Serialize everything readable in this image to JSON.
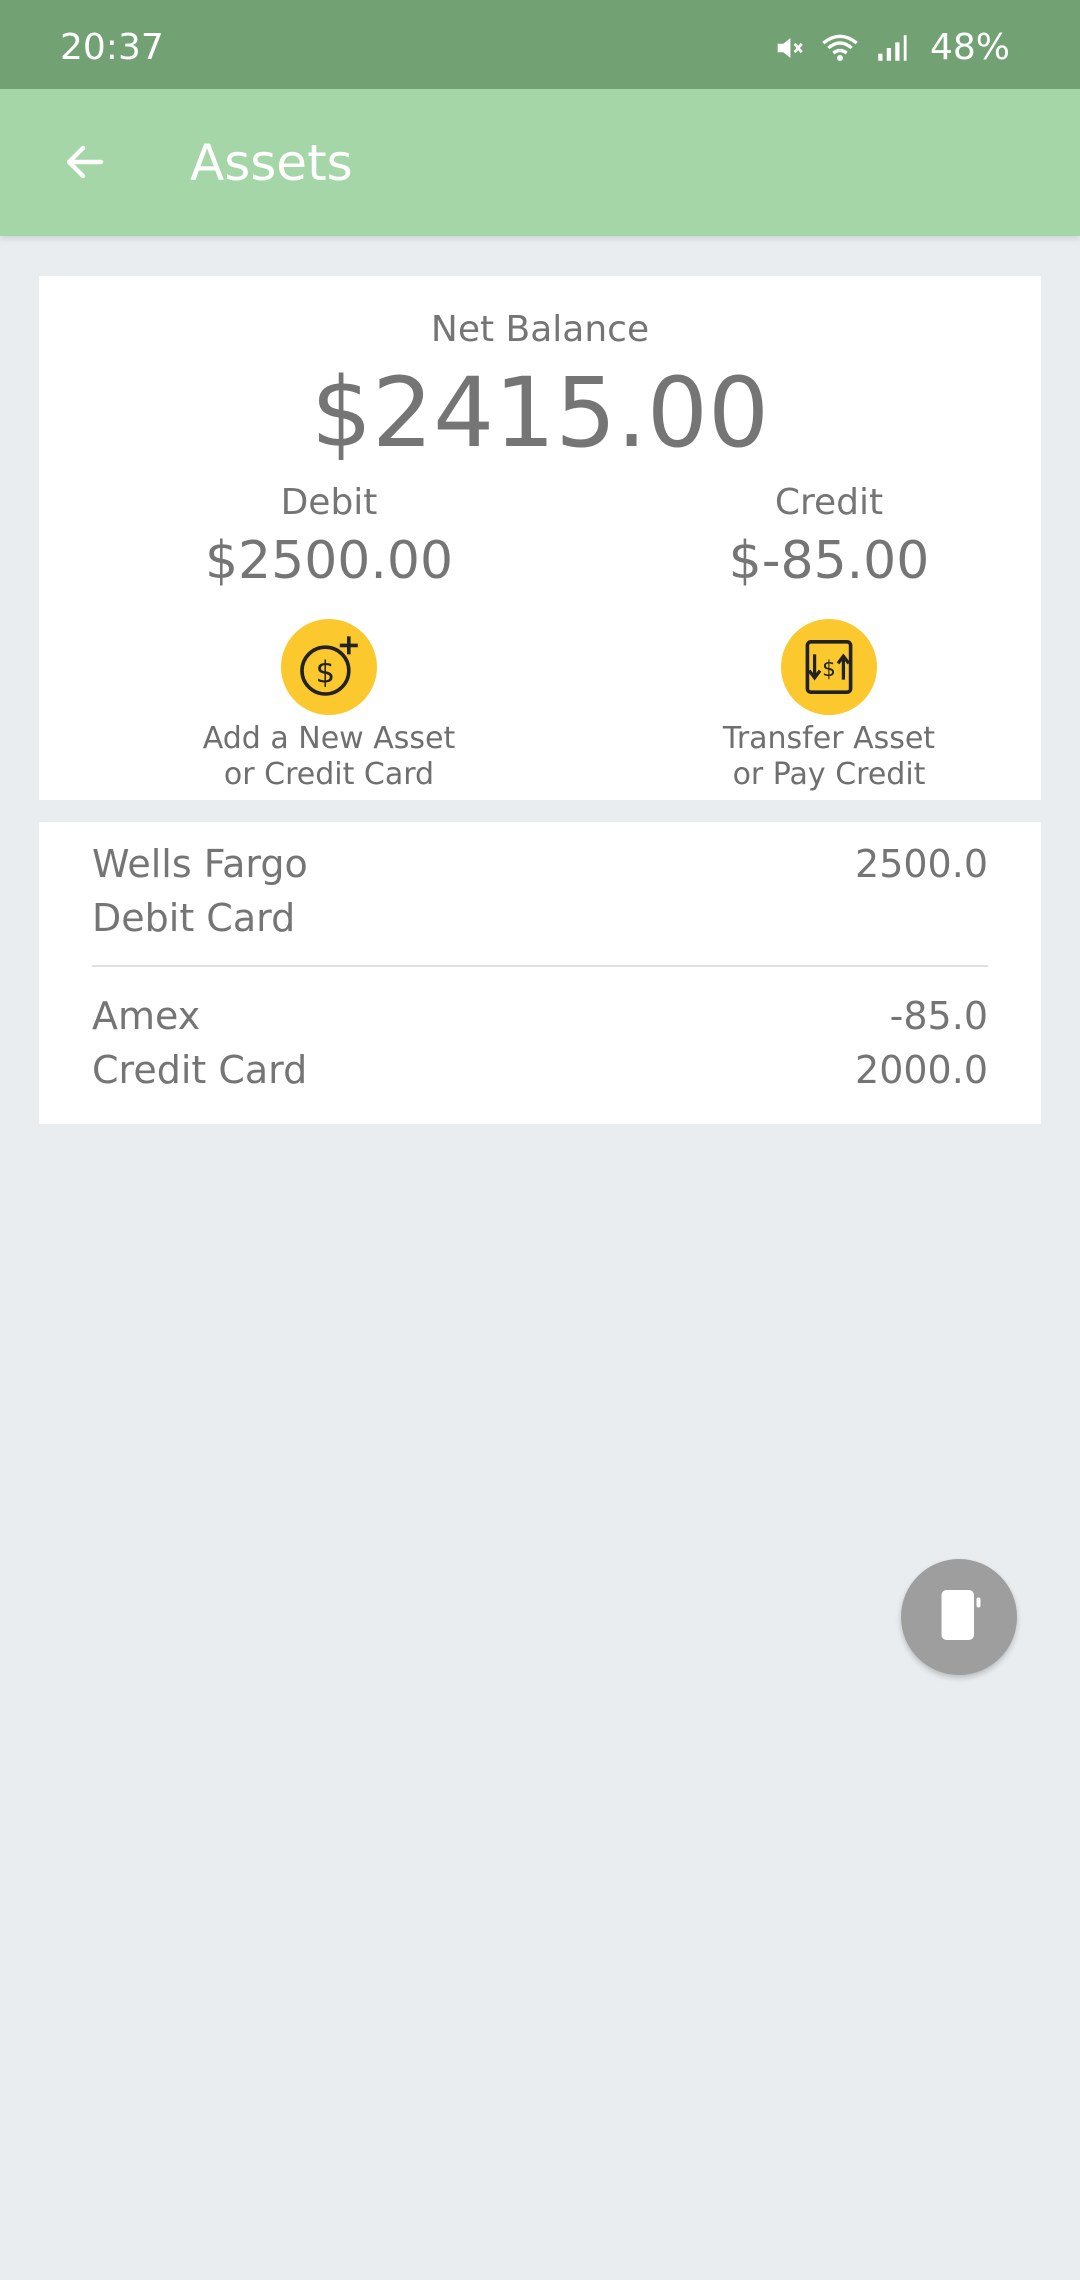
{
  "status_bar": {
    "time": "20:37",
    "battery": "48%",
    "icons": [
      "mute-icon",
      "wifi-icon",
      "signal-icon"
    ]
  },
  "app_bar": {
    "title": "Assets",
    "back_icon": "back-arrow-icon"
  },
  "summary": {
    "net_balance_label": "Net Balance",
    "net_balance_value": "$2415.00",
    "debit_label": "Debit",
    "debit_value": "$2500.00",
    "credit_label": "Credit",
    "credit_value": "$-85.00",
    "add_asset_line1": "Add a New Asset",
    "add_asset_line2": "or Credit Card",
    "add_asset_icon": "dollar-coin-plus-icon",
    "transfer_line1": "Transfer Asset",
    "transfer_line2": "or Pay Credit",
    "transfer_icon": "transfer-dollar-icon"
  },
  "accounts": [
    {
      "name": "Wells Fargo",
      "type": "Debit Card",
      "balance": "2500.0",
      "limit": ""
    },
    {
      "name": "Amex",
      "type": "Credit Card",
      "balance": "-85.0",
      "limit": "2000.0"
    }
  ],
  "fab": {
    "icon": "device-icon"
  },
  "colors": {
    "status_bar": "#72a174",
    "app_bar": "#a5d6a7",
    "background": "#e9edf0",
    "accent_yellow": "#fbc82e",
    "text_gray": "#757575",
    "fab": "#9e9e9e"
  }
}
